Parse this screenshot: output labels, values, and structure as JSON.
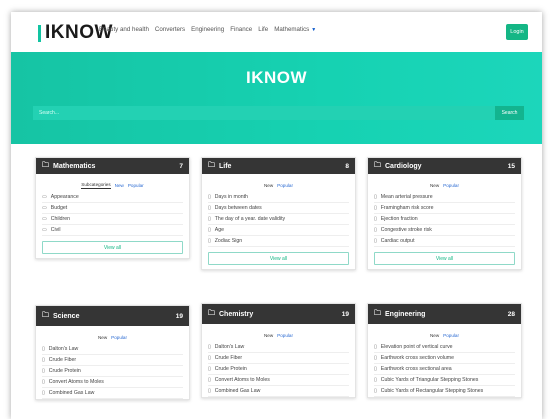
{
  "brand": {
    "logo": "IKNOW"
  },
  "nav": {
    "links": [
      "Beauty and health",
      "Converters",
      "Engineering",
      "Finance",
      "Life",
      "Mathematics"
    ],
    "login_label": "Login"
  },
  "hero": {
    "title": "IKNOW",
    "search_placeholder": "Search...",
    "search_button": "Search"
  },
  "colors": {
    "accent": "#14b685",
    "hero": "#16c4a4",
    "card_header": "#353535"
  },
  "cards": [
    {
      "title": "Mathematics",
      "count": "7",
      "tabs": [
        "Subcategories",
        "New",
        "Popular"
      ],
      "items": [
        "Appearance",
        "Budget",
        "Children",
        "Civil"
      ],
      "view_all": "View all"
    },
    {
      "title": "Life",
      "count": "8",
      "tabs": [
        "New",
        "Popular"
      ],
      "items": [
        "Days in month",
        "Days between dates",
        "The day of a year. date validity",
        "Age",
        "Zodiac Sign"
      ],
      "view_all": "View all"
    },
    {
      "title": "Cardiology",
      "count": "15",
      "tabs": [
        "New",
        "Popular"
      ],
      "items": [
        "Mean arterial pressure",
        "Framingham risk score",
        "Ejection fraction",
        "Congestive stroke risk",
        "Cardiac output"
      ],
      "view_all": "View all"
    },
    {
      "title": "Science",
      "count": "19",
      "tabs": [
        "New",
        "Popular"
      ],
      "items": [
        "Dalton's Law",
        "Crude Fiber",
        "Crude Protein",
        "Convert Atoms to Moles",
        "Combined Gas Law"
      ]
    },
    {
      "title": "Chemistry",
      "count": "19",
      "tabs": [
        "New",
        "Popular"
      ],
      "items": [
        "Dalton's Law",
        "Crude Fiber",
        "Crude Protein",
        "Convert Atoms to Moles",
        "Combined Gas Law"
      ]
    },
    {
      "title": "Engineering",
      "count": "28",
      "tabs": [
        "New",
        "Popular"
      ],
      "items": [
        "Elevation point of vertical curve",
        "Earthwork cross section volume",
        "Earthwork cross sectional area",
        "Cubic Yards of Triangular Stepping Stones",
        "Cubic Yards of Rectangular Stepping Stones"
      ]
    }
  ]
}
